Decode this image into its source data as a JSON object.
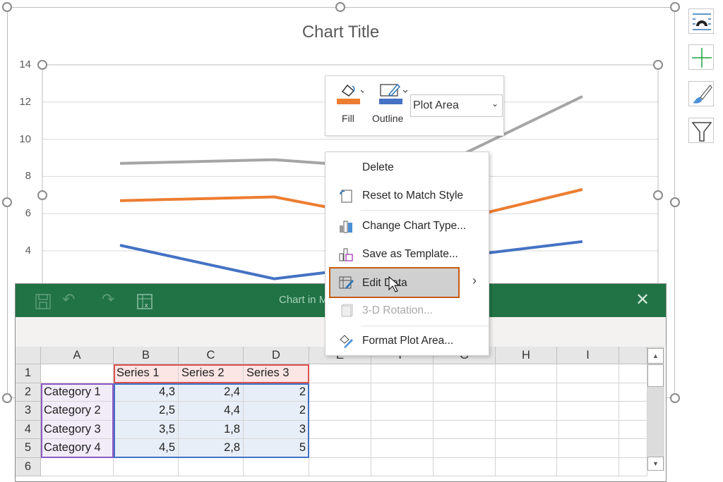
{
  "chart": {
    "title": "Chart Title",
    "y_ticks": [
      "14",
      "12",
      "10",
      "8",
      "6",
      "4"
    ]
  },
  "chart_data": {
    "type": "line",
    "stacked": true,
    "categories": [
      "Category 1",
      "Category 2",
      "Category 3",
      "Category 4"
    ],
    "series": [
      {
        "name": "Series 1",
        "values": [
          4.3,
          2.5,
          3.5,
          4.5
        ],
        "color": "#4472C4"
      },
      {
        "name": "Series 2",
        "values": [
          2.4,
          4.4,
          1.8,
          2.8
        ],
        "color": "#ED7D31"
      },
      {
        "name": "Series 3",
        "values": [
          2,
          2,
          3,
          5
        ],
        "color": "#A5A5A5"
      }
    ],
    "ylim": [
      0,
      14
    ],
    "grid": true
  },
  "side_buttons": [
    "chart-elements-icon",
    "add-element-icon",
    "chart-styles-icon",
    "chart-filters-icon"
  ],
  "mini_toolbar": {
    "fill": "Fill",
    "outline": "Outline",
    "selection": "Plot Area",
    "fill_color": "#ED7D31",
    "outline_color": "#4472C4"
  },
  "context_menu": {
    "items": [
      {
        "label": "Delete",
        "icon": "none"
      },
      {
        "label": "Reset to Match Style",
        "icon": "reset-style-icon"
      },
      {
        "label": "Change Chart Type...",
        "icon": "chart-type-icon"
      },
      {
        "label": "Save as Template...",
        "icon": "save-template-icon"
      },
      {
        "label": "Edit Data",
        "icon": "edit-data-icon",
        "highlighted": true,
        "submenu": true
      },
      {
        "label": "3-D Rotation...",
        "icon": "rotation-3d-icon",
        "disabled": true
      },
      {
        "label": "Format Plot Area...",
        "icon": "format-plot-area-icon"
      }
    ]
  },
  "sheet_window": {
    "title": "Chart in M",
    "accent": "#217346",
    "columns": [
      "A",
      "B",
      "C",
      "D",
      "E",
      "F",
      "G",
      "H",
      "I"
    ],
    "rows": [
      "1",
      "2",
      "3",
      "4",
      "5",
      "6"
    ],
    "cells": [
      [
        "",
        "Series 1",
        "Series 2",
        "Series 3"
      ],
      [
        "Category 1",
        "4,3",
        "2,4",
        "2"
      ],
      [
        "Category 2",
        "2,5",
        "4,4",
        "2"
      ],
      [
        "Category 3",
        "3,5",
        "1,8",
        "3"
      ],
      [
        "Category 4",
        "4,5",
        "2,8",
        "5"
      ],
      [
        "",
        "",
        "",
        ""
      ]
    ]
  }
}
